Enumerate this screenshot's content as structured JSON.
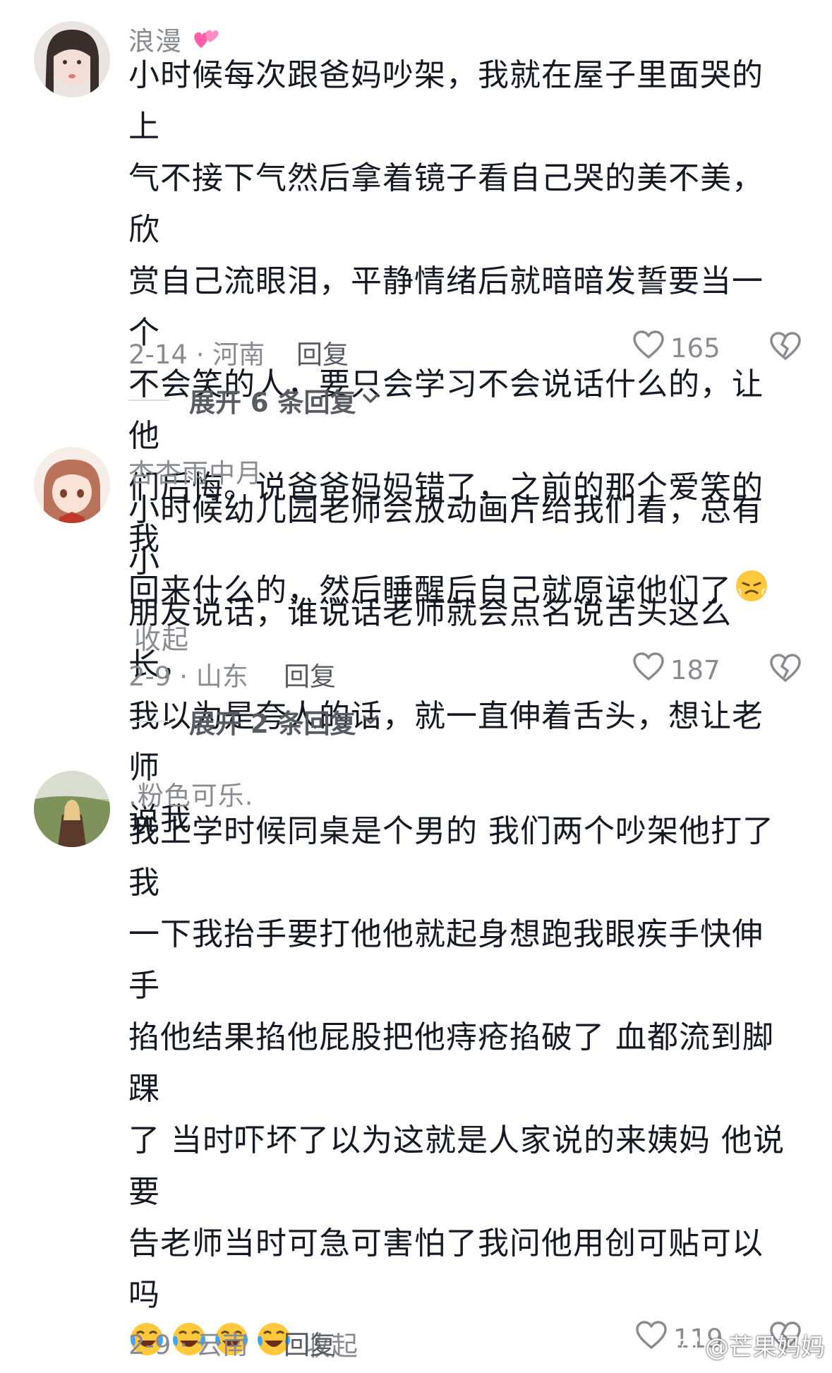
{
  "comments": [
    {
      "username": "浪漫",
      "lines": [
        "小时候每次跟爸妈吵架，我就在屋子里面哭的上",
        "气不接下气然后拿着镜子看自己哭的美不美，欣",
        "赏自己流眼泪，平静情绪后就暗暗发誓要当一个",
        "不会笑的人，要只会学习不会说话什么的，让他",
        "们后悔。说爸爸妈妈错了，之前的那个爱笑的我",
        "回来什么的，然后睡醒后自己就原谅他们了"
      ],
      "collapse": "收起",
      "date_location": "2-14 · 河南",
      "reply": "回复",
      "likes": "165",
      "expand": "展开 6 条回复"
    },
    {
      "username": "杏杏雨中月",
      "lines": [
        "小时候幼儿园老师会放动画片给我们看，总有小",
        "朋友说话，谁说话老师就会点名说舌头这么长，",
        "我以为是夸人的话，就一直伸着舌头，想让老师",
        "说我"
      ],
      "date_location": "2-9 · 山东",
      "reply": "回复",
      "likes": "187",
      "expand": "展开 2 条回复"
    },
    {
      "username": ".粉色可乐.",
      "lines": [
        "我上学时候同桌是个男的 我们两个吵架他打了我",
        "一下我抬手要打他他就起身想跑我眼疾手快伸手",
        "掐他结果掐他屁股把他痔疮掐破了 血都流到脚踝",
        "了 当时吓坏了以为这就是人家说的来姨妈 他说要",
        "告老师当时可急可害怕了我问他用创可贴可以吗"
      ],
      "collapse": "收起",
      "date_location": "2-9 · 云南",
      "reply": "回复",
      "likes": "119"
    }
  ],
  "watermark": "@芒果妈妈",
  "colors": {
    "text": "#161823",
    "muted": "#8a8b91",
    "emoji": "#ffc83d"
  }
}
